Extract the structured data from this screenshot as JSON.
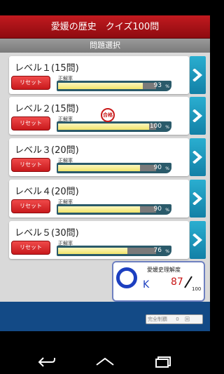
{
  "app": {
    "title": "愛媛の歴史　クイズ100問",
    "subtitle": "問題選択"
  },
  "colors": {
    "title_red": "#b51218",
    "arrow_blue": "#1a95bf",
    "reset_red": "#e0383b",
    "bar_fill": "#f3e87a",
    "footer_blue": "#134a86"
  },
  "levels": [
    {
      "title": "レベル１(15問)",
      "reset_label": "リセット",
      "rate_label": "正解率",
      "value": "93",
      "unit": "%",
      "fill": 0.93
    },
    {
      "title": "レベル２(15問)",
      "reset_label": "リセット",
      "rate_label": "正解率",
      "value": "100",
      "unit": "%",
      "fill": 1.0,
      "stamp": "合格"
    },
    {
      "title": "レベル３(20問)",
      "reset_label": "リセット",
      "rate_label": "正解率",
      "value": "90",
      "unit": "%",
      "fill": 0.9
    },
    {
      "title": "レベル４(20問)",
      "reset_label": "リセット",
      "rate_label": "正解率",
      "value": "90",
      "unit": "%",
      "fill": 0.9
    },
    {
      "title": "レベル５(30問)",
      "reset_label": "リセット",
      "rate_label": "正解率",
      "value": "76",
      "unit": "%",
      "fill": 0.76
    }
  ],
  "understanding": {
    "title": "愛媛史理解度",
    "grade_letter": "K",
    "score": "87",
    "max": "100"
  },
  "footer": {
    "complete_label": "完全制覇",
    "complete_count": "0",
    "complete_unit": "回"
  },
  "icons": {
    "arrow": "chevron-right-icon",
    "back": "back-icon",
    "home": "home-icon",
    "recents": "recents-icon"
  }
}
